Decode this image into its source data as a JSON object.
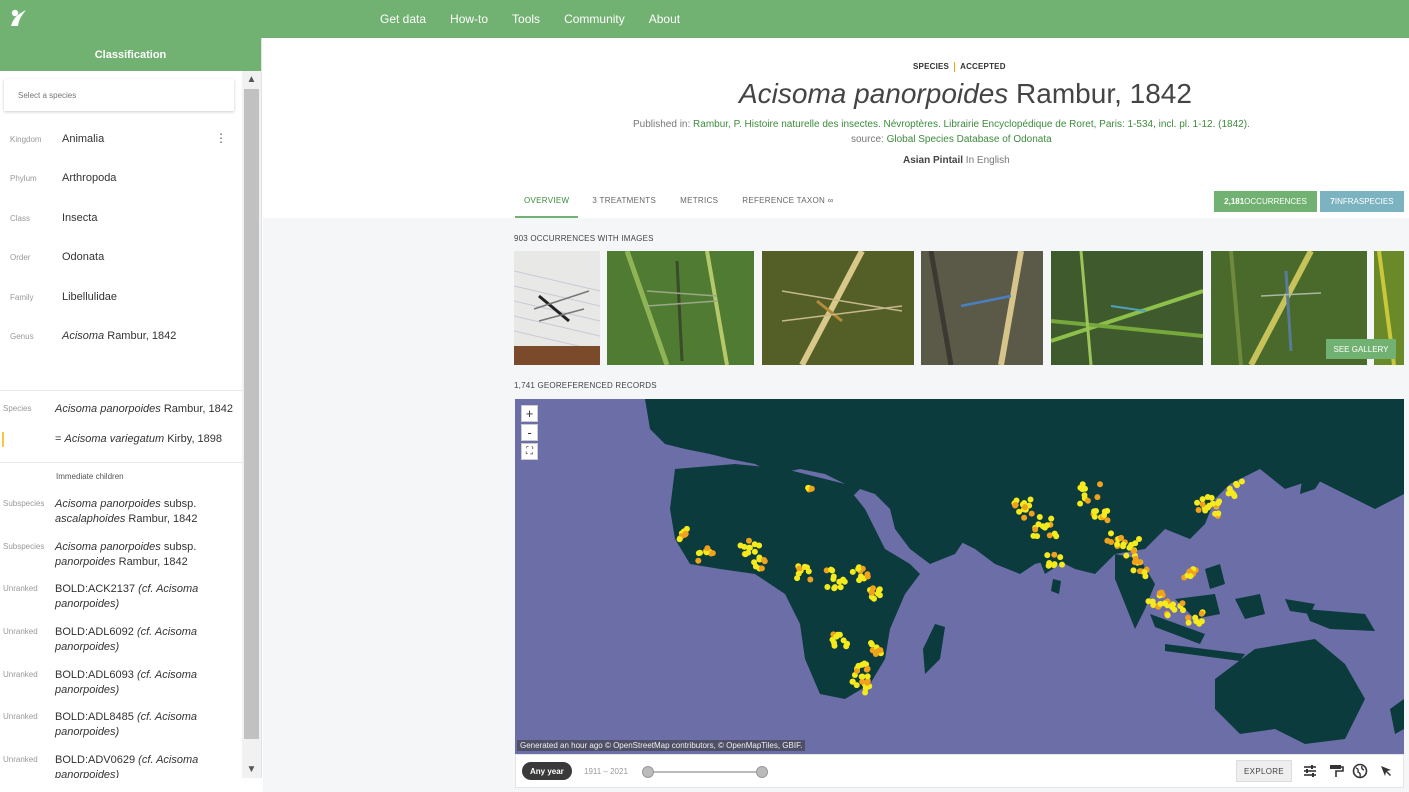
{
  "nav": {
    "items": [
      "Get data",
      "How-to",
      "Tools",
      "Community",
      "About"
    ]
  },
  "sidebar": {
    "title": "Classification",
    "search_placeholder": "Select a species",
    "ranks": [
      {
        "label": "Kingdom",
        "value": "Animalia"
      },
      {
        "label": "Phylum",
        "value": "Arthropoda"
      },
      {
        "label": "Class",
        "value": "Insecta"
      },
      {
        "label": "Order",
        "value": "Odonata"
      },
      {
        "label": "Family",
        "value": "Libellulidae"
      }
    ],
    "genus": {
      "label": "Genus",
      "name": "Acisoma",
      "author": " Rambur, 1842"
    },
    "species": {
      "label": "Species",
      "name": "Acisoma panorpoides",
      "author": " Rambur, 1842"
    },
    "synonym": {
      "prefix": "= ",
      "name": "Acisoma variegatum",
      "author": " Kirby, 1898"
    },
    "immediate_children_label": "Immediate children",
    "children": [
      {
        "rank": "Subspecies",
        "name": "Acisoma panorpoides",
        "mid": " subsp. ",
        "epithet": "ascalaphoides",
        "author": " Rambur, 1842"
      },
      {
        "rank": "Subspecies",
        "name": "Acisoma panorpoides",
        "mid": " subsp. ",
        "epithet": "panorpoides",
        "author": " Rambur, 1842"
      },
      {
        "rank": "Unranked",
        "code": "BOLD:ACK2137",
        "cf": " (cf. Acisoma",
        "cf2": "panorpoides)"
      },
      {
        "rank": "Unranked",
        "code": "BOLD:ADL6092",
        "cf": " (cf. Acisoma",
        "cf2": "panorpoides)"
      },
      {
        "rank": "Unranked",
        "code": "BOLD:ADL6093",
        "cf": " (cf. Acisoma",
        "cf2": "panorpoides)"
      },
      {
        "rank": "Unranked",
        "code": "BOLD:ADL8485",
        "cf": " (cf. Acisoma",
        "cf2": "panorpoides)"
      },
      {
        "rank": "Unranked",
        "code": "BOLD:ADV0629",
        "cf": " (cf. Acisoma",
        "cf2": "panorpoides)"
      }
    ]
  },
  "header": {
    "rank": "SPECIES",
    "status": "ACCEPTED",
    "title_name": "Acisoma panorpoides",
    "title_author": " Rambur, 1842",
    "published_prefix": "Published in: ",
    "published_ref": "Rambur, P. Histoire naturelle des insectes. Névroptères. Librairie Encyclopédique de Roret, Paris: 1-534, incl. pl. 1-12. (1842).",
    "source_prefix": "source: ",
    "source_ref": "Global Species Database of Odonata",
    "vernacular_name": "Asian Pintail",
    "vernacular_lang": " In English"
  },
  "tabs": [
    "OVERVIEW",
    "3 TREATMENTS",
    "METRICS",
    "REFERENCE TAXON ∞"
  ],
  "badges": {
    "occurrences_count": "2,181",
    "occurrences_label": " OCCURRENCES",
    "infraspecies_count": "7",
    "infraspecies_label": " INFRASPECIES"
  },
  "gallery": {
    "label": "903 OCCURRENCES WITH IMAGES",
    "see_gallery": "SEE GALLERY"
  },
  "map": {
    "label": "1,741 GEOREFERENCED RECORDS",
    "attribution": "Generated an hour ago © OpenStreetMap contributors, © OpenMapTiles, GBIF.",
    "zoom_in": "+",
    "zoom_out": "-",
    "any_year": "Any year",
    "year_range": "1911 – 2021",
    "explore": "EXPLORE"
  },
  "colors": {
    "brand_green": "#71b171",
    "ocean": "#6c6ea8",
    "land": "#0b3b3c",
    "dot_yellow": "#f5ea1c",
    "dot_orange": "#f0a21c"
  }
}
